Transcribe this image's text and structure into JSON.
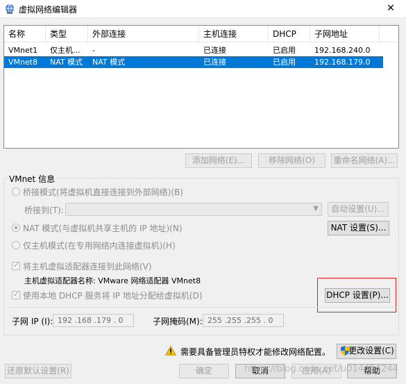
{
  "window": {
    "title": "虚拟网络编辑器",
    "close_glyph": "✕"
  },
  "table": {
    "columns": [
      "名称",
      "类型",
      "外部连接",
      "主机连接",
      "DHCP",
      "子网地址"
    ],
    "rows": [
      {
        "name": "VMnet1",
        "type": "仅主机...",
        "external": "-",
        "host": "已连接",
        "dhcp": "已启用",
        "subnet": "192.168.240.0",
        "selected": false
      },
      {
        "name": "VMnet8",
        "type": "NAT 模式",
        "external": "NAT 模式",
        "host": "已连接",
        "dhcp": "已启用",
        "subnet": "192.168.179.0",
        "selected": true
      }
    ]
  },
  "table_buttons": {
    "add": "添加网络(E)...",
    "remove": "移除网络(O)",
    "rename": "重命名网络(A)..."
  },
  "vmnet_info": {
    "group_label": "VMnet 信息",
    "bridge_mode": "桥接模式(将虚拟机直接连接到外部网络)(B)",
    "bridge_to_label": "桥接到(T):",
    "bridge_to_value": "",
    "auto_settings": "自动设置(U)...",
    "nat_mode": "NAT 模式(与虚拟机共享主机的 IP 地址)(N)",
    "nat_settings": "NAT 设置(S)...",
    "host_only_mode": "仅主机模式(在专用网络内连接虚拟机)(H)",
    "selected_mode": "nat",
    "connect_adapter": "将主机虚拟适配器连接到此网络(V)",
    "connect_adapter_checked": true,
    "adapter_name_label": "主机虚拟适配器名称: VMware 网络适配器 VMnet8",
    "use_dhcp": "使用本地 DHCP 服务将 IP 地址分配给虚拟机(D)",
    "use_dhcp_checked": true,
    "dhcp_settings": "DHCP 设置(P)...",
    "subnet_ip_label": "子网 IP (I):",
    "subnet_ip_value": "192 .168 .179 . 0",
    "subnet_mask_label": "子网掩码(M):",
    "subnet_mask_value": "255 .255 .255 . 0"
  },
  "admin": {
    "warning_text": "需要具备管理员特权才能修改网络配置。",
    "change_settings": "更改设置(C)"
  },
  "footer": {
    "restore_defaults": "还原默认设置(R)",
    "ok": "确定",
    "cancel": "取消",
    "apply": "应用(A)",
    "help": "帮助"
  },
  "watermark": "https://blog.csdn.net/u014454244",
  "colors": {
    "selection": "#0078d7",
    "highlight_border": "#e02020",
    "warning": "#f5c400"
  }
}
